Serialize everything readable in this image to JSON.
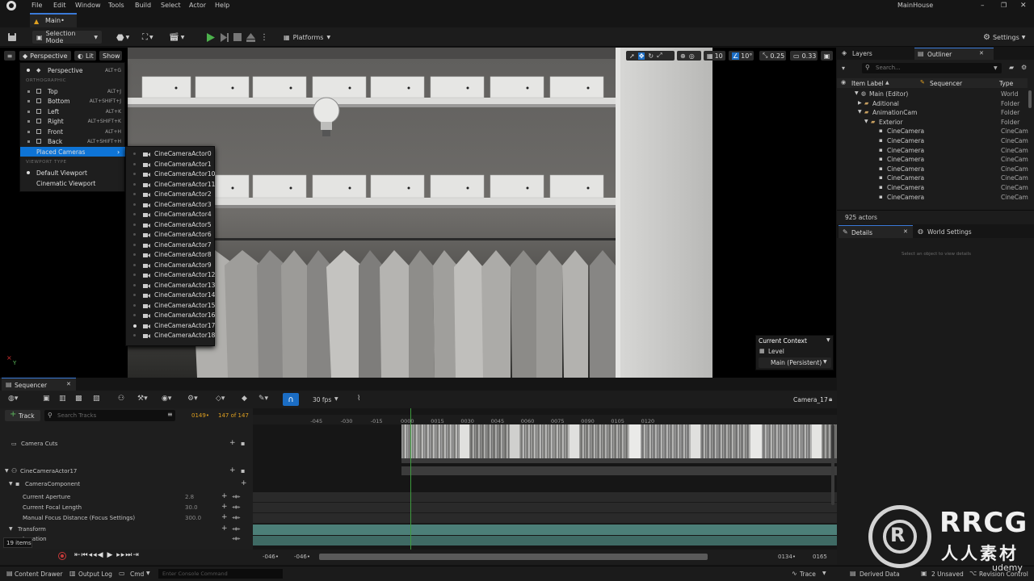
{
  "menubar": {
    "items": [
      "File",
      "Edit",
      "Window",
      "Tools",
      "Build",
      "Select",
      "Actor",
      "Help"
    ],
    "project_name": "MainHouse"
  },
  "document_tab": {
    "label": "Main•"
  },
  "toolbar": {
    "selection_mode": "Selection Mode",
    "platforms": "Platforms",
    "settings": "Settings"
  },
  "viewport": {
    "perspective_label": "Perspective",
    "lit_label": "Lit",
    "show_label": "Show",
    "grid_size": "10",
    "rotation_snap": "10°",
    "scale_snap": "0.25",
    "camera_speed": "0.33",
    "axis_label": "Y"
  },
  "view_menu": {
    "perspective": {
      "label": "Perspective",
      "shortcut": "ALT+G"
    },
    "orthographic_header": "ORTHOGRAPHIC",
    "ortho_items": [
      {
        "label": "Top",
        "shortcut": "ALT+J"
      },
      {
        "label": "Bottom",
        "shortcut": "ALT+SHIFT+J"
      },
      {
        "label": "Left",
        "shortcut": "ALT+K"
      },
      {
        "label": "Right",
        "shortcut": "ALT+SHIFT+K"
      },
      {
        "label": "Front",
        "shortcut": "ALT+H"
      },
      {
        "label": "Back",
        "shortcut": "ALT+SHIFT+H"
      }
    ],
    "placed_cameras": "Placed Cameras",
    "viewport_type_header": "VIEWPORT TYPE",
    "default_viewport": "Default Viewport",
    "cinematic_viewport": "Cinematic Viewport"
  },
  "camera_menu": {
    "items": [
      "CineCameraActor0",
      "CineCameraActor1",
      "CineCameraActor10",
      "CineCameraActor11",
      "CineCameraActor2",
      "CineCameraActor3",
      "CineCameraActor4",
      "CineCameraActor5",
      "CineCameraActor6",
      "CineCameraActor7",
      "CineCameraActor8",
      "CineCameraActor9",
      "CineCameraActor12",
      "CineCameraActor13",
      "CineCameraActor14",
      "CineCameraActor15",
      "CineCameraActor16",
      "CineCameraActor17",
      "CineCameraActor18"
    ],
    "selected": "CineCameraActor17"
  },
  "current_context": {
    "title": "Current Context",
    "level_label": "Level",
    "level_value": "Main (Persistent)"
  },
  "outliner": {
    "layers_tab": "Layers",
    "outliner_tab": "Outliner",
    "search_placeholder": "Search...",
    "col_item_label": "Item Label",
    "col_sequencer": "Sequencer",
    "col_type": "Type",
    "rows": [
      {
        "label": "Main (Editor)",
        "type": "World"
      },
      {
        "label": "Aditional",
        "type": "Folder"
      },
      {
        "label": "AnimationCam",
        "type": "Folder"
      },
      {
        "label": "Exterior",
        "type": "Folder"
      },
      {
        "label": "CineCamera",
        "type": "CineCam"
      },
      {
        "label": "CineCamera",
        "type": "CineCam"
      },
      {
        "label": "CineCamera",
        "type": "CineCam"
      },
      {
        "label": "CineCamera",
        "type": "CineCam"
      },
      {
        "label": "CineCamera",
        "type": "CineCam"
      },
      {
        "label": "CineCamera",
        "type": "CineCam"
      },
      {
        "label": "CineCamera",
        "type": "CineCam"
      },
      {
        "label": "CineCamera",
        "type": "CineCam"
      }
    ],
    "actor_count": "925 actors"
  },
  "details": {
    "details_tab": "Details",
    "world_settings_tab": "World Settings",
    "empty_text": "Select an object to view details"
  },
  "sequencer": {
    "tab": "Sequencer",
    "fps": "30 fps",
    "camera_name": "Camera_17",
    "add_track": "Track",
    "search_placeholder": "Search Tracks",
    "current_frame": "0149•",
    "frame_count": "147 of 147",
    "tracks": {
      "camera_cuts": "Camera Cuts",
      "actor": "CineCameraActor17",
      "component": "CameraComponent",
      "aperture_label": "Current Aperture",
      "aperture_value": "2.8",
      "focal_label": "Current Focal Length",
      "focal_value": "30.0",
      "focus_label": "Manual Focus Distance (Focus Settings)",
      "focus_value": "300.0",
      "transform": "Transform",
      "location": "Location"
    },
    "item_count": "19 items",
    "ruler": [
      "-045",
      "-030",
      "-015",
      "0000",
      "0015",
      "0030",
      "0045",
      "0060",
      "0075",
      "0090",
      "0105",
      "0120"
    ],
    "playhead_value": 0,
    "range_start_a": "-046•",
    "range_start_b": "-046•",
    "range_end_a": "0134•",
    "range_end_b": "0165"
  },
  "statusbar": {
    "content_drawer": "Content Drawer",
    "output_log": "Output Log",
    "cmd": "Cmd",
    "console_placeholder": "Enter Console Command",
    "trace": "Trace",
    "derived_data": "Derived Data",
    "unsaved": "2 Unsaved",
    "revision": "Revision Control"
  },
  "watermark": {
    "text1": "RRCG",
    "text2": "人人素材",
    "udemy": "udemy"
  }
}
